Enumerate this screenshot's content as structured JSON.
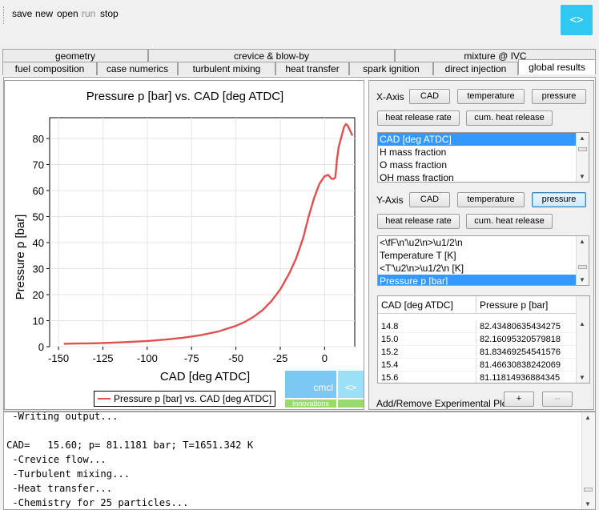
{
  "toolbar": {
    "items": [
      {
        "label": "save",
        "enabled": true
      },
      {
        "label": "new",
        "enabled": true
      },
      {
        "label": "open",
        "enabled": true
      },
      {
        "label": "run",
        "enabled": false
      },
      {
        "label": "stop",
        "enabled": true
      }
    ],
    "brand_icon": "code-brackets-icon",
    "brand_symbol": "<>"
  },
  "tabs_row1": [
    "geometry",
    "crevice & blow-by",
    "mixture @ IVC"
  ],
  "tabs_row2": [
    "fuel composition",
    "case numerics",
    "turbulent mixing",
    "heat transfer",
    "spark ignition",
    "direct injection",
    "global results"
  ],
  "active_tab": "global results",
  "chart_data": {
    "type": "line",
    "title": "Pressure p [bar] vs. CAD [deg ATDC]",
    "xlabel": "CAD [deg ATDC]",
    "ylabel": "Pressure p [bar]",
    "xlim": [
      -155,
      17
    ],
    "ylim": [
      0,
      88
    ],
    "xticks": [
      -150,
      -125,
      -100,
      -75,
      -50,
      -25,
      0,
      25
    ],
    "yticks": [
      0,
      10,
      20,
      30,
      40,
      50,
      60,
      70,
      80
    ],
    "grid": true,
    "legend_position": "bottom-center",
    "series": [
      {
        "name": "Pressure p [bar] vs. CAD [deg ATDC]",
        "color": "#e05050",
        "x": [
          -147,
          -140,
          -130,
          -120,
          -110,
          -100,
          -90,
          -80,
          -70,
          -60,
          -50,
          -45,
          -40,
          -35,
          -30,
          -25,
          -20,
          -16,
          -12,
          -9,
          -6,
          -3,
          0,
          2,
          4,
          5,
          6,
          6.5,
          7,
          8,
          10,
          11,
          12,
          13,
          14,
          14.8,
          15.0,
          15.2,
          15.4,
          15.6
        ],
        "y": [
          1.1,
          1.2,
          1.3,
          1.5,
          1.8,
          2.2,
          2.7,
          3.4,
          4.4,
          5.8,
          8.0,
          9.5,
          11.5,
          14.0,
          17.5,
          22.0,
          28.0,
          34.0,
          42.0,
          50.0,
          57.0,
          62.5,
          65.5,
          66.0,
          64.5,
          64.5,
          65.0,
          68.0,
          72.0,
          77.0,
          82.0,
          84.5,
          85.5,
          85.0,
          83.5,
          82.43,
          82.16,
          81.83,
          81.47,
          81.12
        ]
      }
    ]
  },
  "controls": {
    "x_axis_label": "X-Axis",
    "y_axis_label": "Y-Axis",
    "axis_buttons": [
      "CAD",
      "temperature",
      "pressure"
    ],
    "rate_buttons": [
      "heat release rate",
      "cum. heat release"
    ],
    "x_selected": "",
    "y_selected": "pressure",
    "x_list": [
      "CAD [deg ATDC]",
      "H mass fraction",
      "O mass fraction",
      "OH mass fraction"
    ],
    "x_list_selected": 0,
    "y_list": [
      "<\\fF\\n'\\u2\\n>\\u1/2\\n",
      "Temperature T [K]",
      "<T'\\u2\\n>\\u1/2\\n [K]",
      "Pressure p [bar]"
    ],
    "y_list_selected": 3,
    "exp_plot_label": "Add/Remove Experimental Plot",
    "add_label": "+",
    "remove_label": "--"
  },
  "table": {
    "headers": [
      "CAD [deg ATDC]",
      "Pressure p [bar]"
    ],
    "rows": [
      [
        "14.8",
        "82.43480635434275"
      ],
      [
        "15.0",
        "82.16095320579818"
      ],
      [
        "15.2",
        "81.83469254541576"
      ],
      [
        "15.4",
        "81.46630838242069"
      ],
      [
        "15.6",
        "81.11814936884345"
      ]
    ]
  },
  "logo": {
    "text": "cmcl",
    "subtext": "innovations",
    "symbol": "<>"
  },
  "console": {
    "lines": [
      " -Writing output...",
      "",
      "CAD=   15.60; p= 81.1181 bar; T=1651.342 K",
      " -Crevice flow...",
      " -Turbulent mixing...",
      " -Heat transfer...",
      " -Chemistry for 25 particles..."
    ]
  }
}
